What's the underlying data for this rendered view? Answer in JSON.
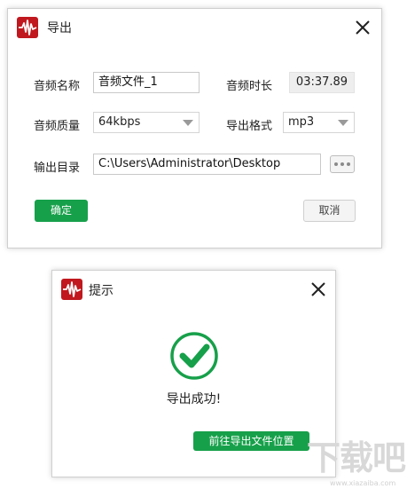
{
  "export_dialog": {
    "title": "导出",
    "name_label": "音频名称",
    "name_value": "音频文件_1",
    "duration_label": "音频时长",
    "duration_value": "03:37.89",
    "quality_label": "音频质量",
    "quality_value": "64kbps",
    "format_label": "导出格式",
    "format_value": "mp3",
    "output_label": "输出目录",
    "output_value": "C:\\Users\\Administrator\\Desktop",
    "confirm_label": "确定",
    "cancel_label": "取消"
  },
  "tip_dialog": {
    "title": "提示",
    "message": "导出成功!",
    "open_location_label": "前往导出文件位置"
  },
  "watermark": {
    "text": "下载吧",
    "sub": "www.xiazaiba.com"
  },
  "colors": {
    "accent_green": "#17a04a",
    "logo_red": "#c0181e"
  },
  "icons": {
    "app_logo": "waveform-icon",
    "close": "close-icon",
    "success": "check-circle-icon",
    "browse": "ellipsis-icon"
  }
}
